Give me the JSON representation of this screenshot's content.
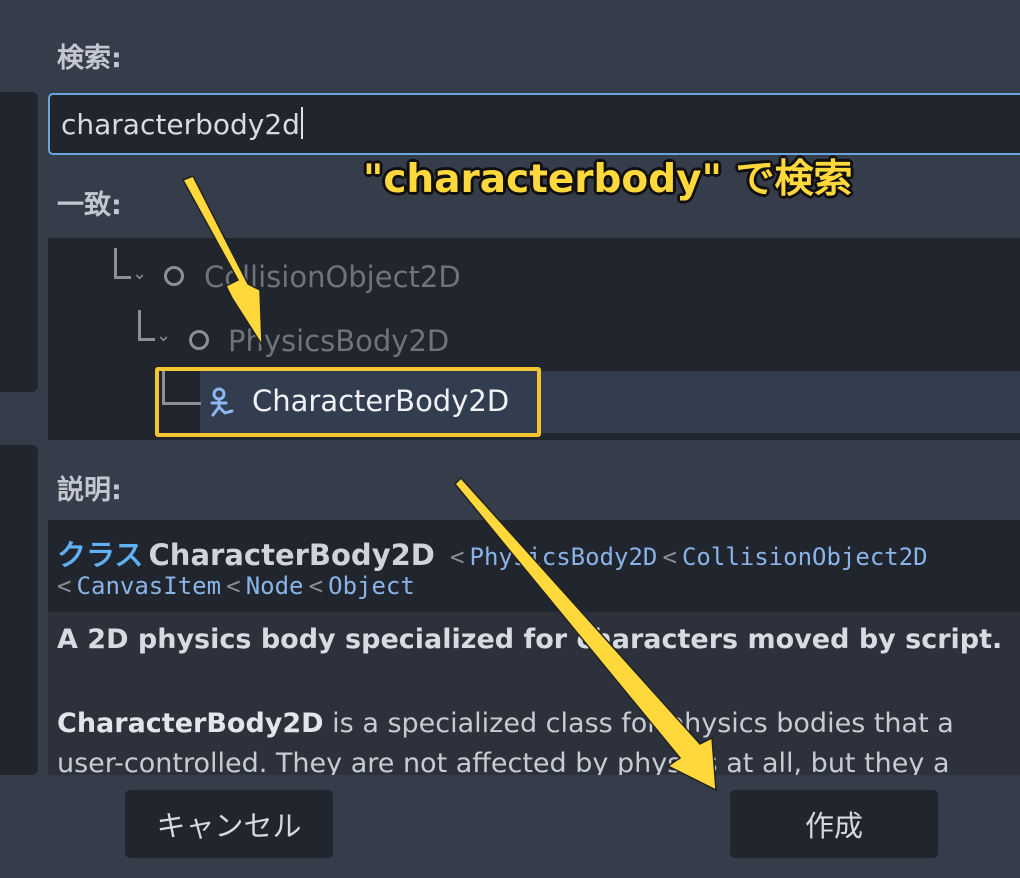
{
  "search": {
    "label": "検索:",
    "value": "characterbody2d"
  },
  "annotation": {
    "text": "\"characterbody\" で検索",
    "color": "#ffd93b"
  },
  "matches": {
    "label": "一致:",
    "items": [
      {
        "label": "CollisionObject2D",
        "icon": "circle-node-icon"
      },
      {
        "label": "PhysicsBody2D",
        "icon": "circle-node-icon"
      },
      {
        "label": "CharacterBody2D",
        "icon": "character-body-icon",
        "selected": true
      }
    ]
  },
  "description": {
    "label": "説明:",
    "class_keyword": "クラス",
    "class_name": "CharacterBody2D",
    "inherits": [
      "PhysicsBody2D",
      "CollisionObject2D",
      "CanvasItem",
      "Node",
      "Object"
    ],
    "separator": "<",
    "brief": "A 2D physics body specialized for characters moved by script.",
    "body_bold": "CharacterBody2D",
    "body_line1_rest": " is a specialized class for physics bodies that a",
    "body_line2": "user-controlled. They are not affected by physics at all, but they a"
  },
  "buttons": {
    "cancel": "キャンセル",
    "create": "作成"
  },
  "colors": {
    "accent": "#6aa5de",
    "highlight": "#f5c531",
    "arrow": "#ffd93b"
  }
}
